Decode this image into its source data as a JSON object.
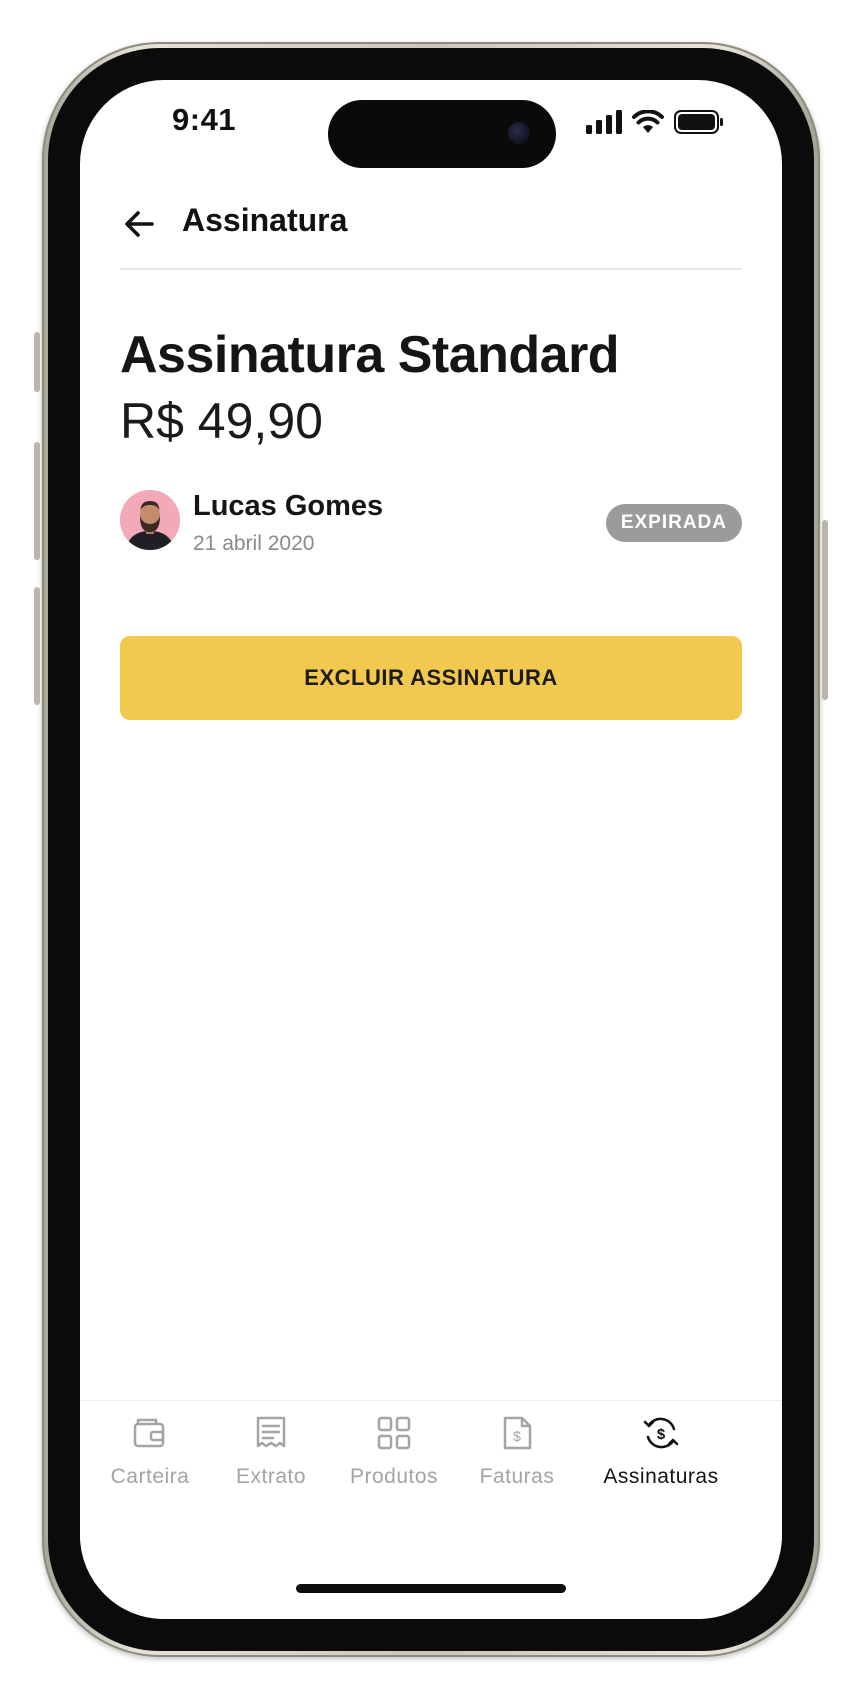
{
  "status_bar": {
    "time": "9:41",
    "icons": [
      "signal-icon",
      "wifi-icon",
      "battery-icon"
    ]
  },
  "header": {
    "title": "Assinatura",
    "back_icon": "arrow-left-icon"
  },
  "subscription": {
    "name": "Assinatura Standard",
    "price": "R$ 49,90",
    "user_name": "Lucas Gomes",
    "date": "21 abril 2020",
    "status": "EXPIRADA"
  },
  "actions": {
    "delete_label": "EXCLUIR ASSINATURA"
  },
  "tabbar": {
    "tabs": [
      {
        "label": "Carteira",
        "icon": "wallet-icon",
        "active": false
      },
      {
        "label": "Extrato",
        "icon": "receipt-icon",
        "active": false
      },
      {
        "label": "Produtos",
        "icon": "grid-icon",
        "active": false
      },
      {
        "label": "Faturas",
        "icon": "invoice-dollar-icon",
        "active": false
      },
      {
        "label": "Assinaturas",
        "icon": "subscription-dollar-icon",
        "active": true
      }
    ]
  },
  "colors": {
    "accent": "#F2C84F",
    "badge": "#9B9B9B",
    "text": "#151515",
    "muted": "#A4A4A4"
  }
}
